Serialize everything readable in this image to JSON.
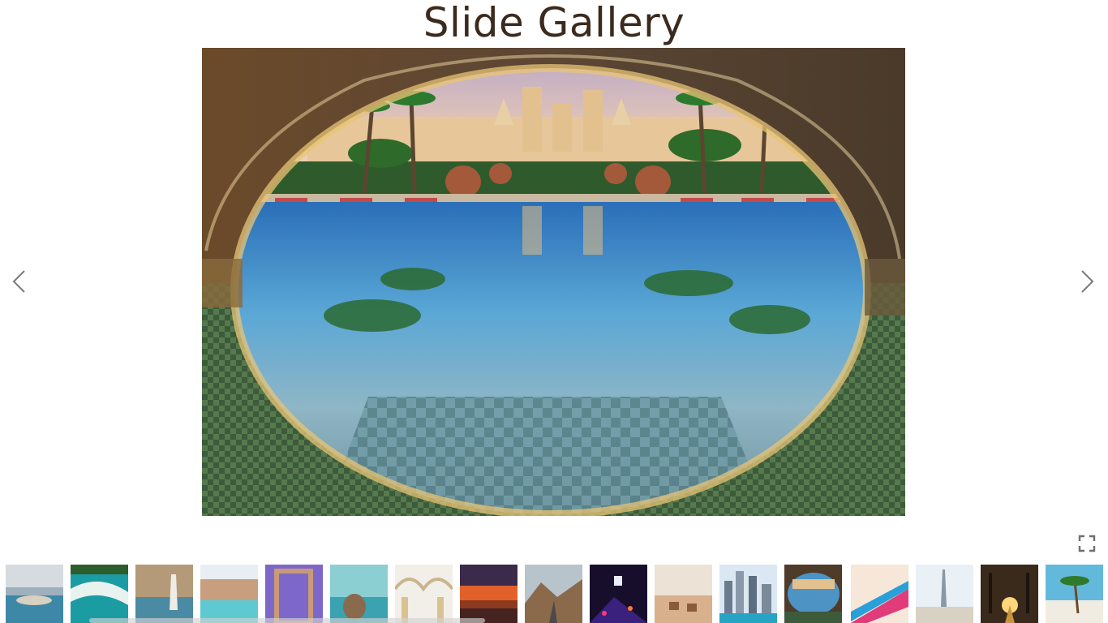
{
  "gallery": {
    "title": "Slide Gallery"
  },
  "controls": {
    "prev_icon": "chevron-left-icon",
    "next_icon": "chevron-right-icon",
    "fullscreen_icon": "fullscreen-icon"
  },
  "thumbnails": [
    {
      "name": "coastal-city-aerial",
      "selected": false
    },
    {
      "name": "turquoise-beach-aerial",
      "selected": false
    },
    {
      "name": "burj-al-arab-aerial",
      "selected": false
    },
    {
      "name": "resort-lagoon",
      "selected": false
    },
    {
      "name": "dubai-frame",
      "selected": false
    },
    {
      "name": "hand-at-sea",
      "selected": false
    },
    {
      "name": "mosque-arches",
      "selected": false
    },
    {
      "name": "sunset-sky",
      "selected": false
    },
    {
      "name": "mountain-road",
      "selected": false
    },
    {
      "name": "city-night-lights",
      "selected": false
    },
    {
      "name": "desert-camels",
      "selected": false
    },
    {
      "name": "marina-skyscrapers",
      "selected": false
    },
    {
      "name": "arched-pool-reflection",
      "selected": true
    },
    {
      "name": "colorful-balcony",
      "selected": false
    },
    {
      "name": "burj-khalifa-plaza",
      "selected": false
    },
    {
      "name": "palm-sunset-path",
      "selected": false
    },
    {
      "name": "palm-beach",
      "selected": false
    }
  ]
}
